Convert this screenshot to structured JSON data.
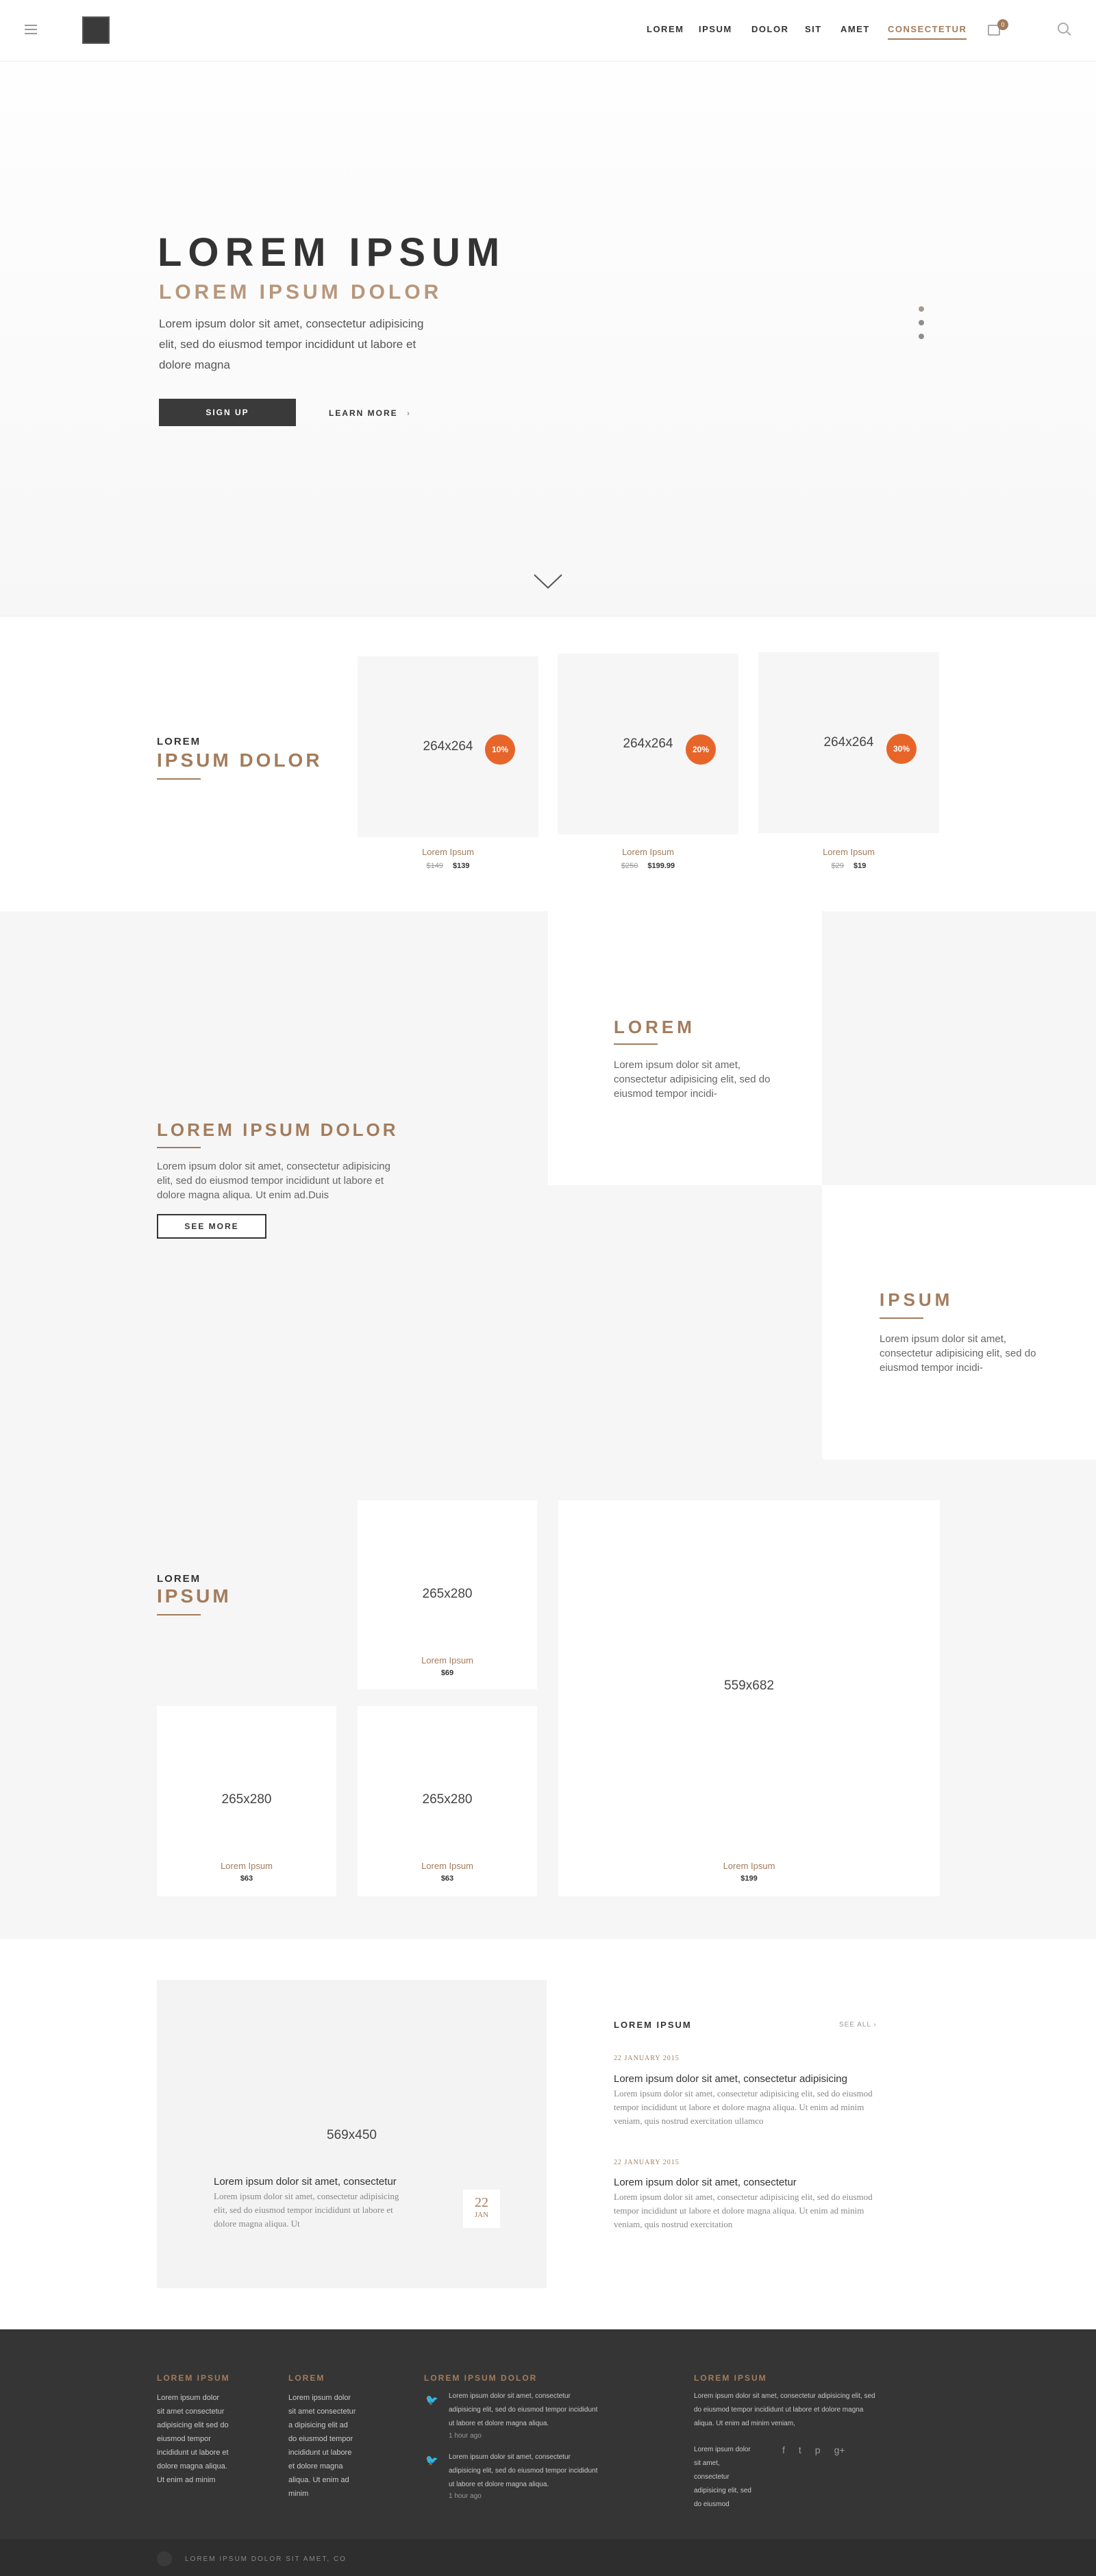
{
  "header": {
    "menu_icon": "hamburger-icon",
    "logo_icon": "logo-square",
    "nav": [
      "LOREM",
      "IPSUM",
      "DOLOR",
      "SIT",
      "AMET",
      "CONSECTETUR"
    ],
    "cart_count": "0",
    "accent": "#a37c5c"
  },
  "hero": {
    "title": "LOREM IPSUM",
    "subtitle": "LOREM IPSUM DOLOR",
    "text": "Lorem ipsum dolor sit amet, consectetur adipisicing elit, sed do eiusmod tempor incididunt ut labore et dolore magna",
    "signup_label": "SIGN UP",
    "learn_more_label": "LEARN MORE",
    "learn_more_arrow": "›"
  },
  "sale": {
    "kicker": "LOREM",
    "title": "IPSUM DOLOR",
    "products": [
      {
        "size": "264x264",
        "badge": "10%",
        "name": "Lorem Ipsum",
        "old_price": "$149",
        "price": "$139"
      },
      {
        "size": "264x264",
        "badge": "20%",
        "name": "Lorem Ipsum",
        "old_price": "$250",
        "price": "$199.99"
      },
      {
        "size": "264x264",
        "badge": "30%",
        "name": "Lorem Ipsum",
        "old_price": "$29",
        "price": "$19"
      }
    ]
  },
  "feature": {
    "title": "LOREM IPSUM DOLOR",
    "text": "Lorem ipsum dolor sit amet, consectetur adipisicing elit, sed do eiusmod tempor incididunt ut labore et dolore magna aliqua. Ut enim ad.Duis",
    "see_more_label": "SEE MORE",
    "box1_title": "LOREM",
    "box1_text": "Lorem ipsum dolor sit amet, consectetur adipisicing elit, sed do eiusmod tempor incidi-",
    "box2_title": "IPSUM",
    "box2_text": "Lorem ipsum dolor sit amet, consectetur adipisicing elit, sed do eiusmod tempor incidi-"
  },
  "collection": {
    "kicker": "LOREM",
    "title": "IPSUM",
    "items": [
      {
        "size": "265x280",
        "name": "Lorem Ipsum",
        "price": "$69"
      },
      {
        "size": "559x682",
        "name": "Lorem Ipsum",
        "price": "$199"
      },
      {
        "size": "265x280",
        "name": "Lorem Ipsum",
        "price": "$63"
      },
      {
        "size": "265x280",
        "name": "Lorem Ipsum",
        "price": "$63"
      }
    ]
  },
  "blog": {
    "feature_size": "569x450",
    "feature_title": "Lorem ipsum dolor sit amet, consectetur",
    "feature_text": "Lorem ipsum dolor sit amet, consectetur adipisicing elit, sed do eiusmod tempor incididunt ut labore et dolore magna aliqua. Ut",
    "date_day": "22",
    "date_month": "JAN",
    "list_title": "LOREM IPSUM",
    "see_all_label": "SEE ALL ›",
    "posts": [
      {
        "date": "22 JANUARY 2015",
        "title": "Lorem ipsum dolor sit amet, consectetur adipisicing",
        "text": "Lorem ipsum dolor sit amet, consectetur adipisicing elit, sed do eiusmod tempor incididunt ut labore et dolore magna aliqua. Ut enim ad minim veniam, quis nostrud exercitation ullamco"
      },
      {
        "date": "22 JANUARY 2015",
        "title": "Lorem ipsum dolor sit amet, consectetur",
        "text": "Lorem ipsum dolor sit amet, consectetur adipisicing elit, sed do eiusmod tempor incididunt ut labore et dolore magna aliqua. Ut enim ad minim veniam, quis nostrud exercitation"
      }
    ]
  },
  "footer": {
    "col1_title": "LOREM IPSUM",
    "col1_text": "Lorem ipsum dolor sit amet consectetur adipisicing elit sed do eiusmod tempor incididunt ut labore et dolore magna aliqua. Ut enim ad minim",
    "col2_title": "LOREM",
    "col2_text": "Lorem ipsum dolor sit amet consectetur a dipisicing elit ad do eiusmod tempor incididunt ut labore et dolore magna aliqua. Ut enim ad minim",
    "col3_title": "LOREM IPSUM DOLOR",
    "tweets": [
      {
        "text": "Lorem ipsum dolor sit amet, consectetur adipisicing elit, sed do eiusmod tempor incididunt ut labore et dolore magna aliqua.",
        "time": "1 hour ago"
      },
      {
        "text": "Lorem ipsum dolor sit amet, consectetur adipisicing elit, sed do eiusmod tempor incididunt ut labore et dolore magna aliqua.",
        "time": "1 hour ago"
      }
    ],
    "col4_title": "LOREM IPSUM",
    "col4_text": "Lorem ipsum dolor sit amet, consectetur adipisicing elit, sed do eiusmod tempor incididunt ut labore et dolore magna aliqua. Ut enim ad minim veniam,",
    "col4_address": "Lorem ipsum dolor sit amet, consectetur adipisicing elit, sed do eiusmod",
    "social_icons": [
      "facebook-icon",
      "twitter-icon",
      "pinterest-icon",
      "google-plus-icon"
    ],
    "copyright": "LOREM IPSUM DOLOR SIT AMET, CO"
  }
}
